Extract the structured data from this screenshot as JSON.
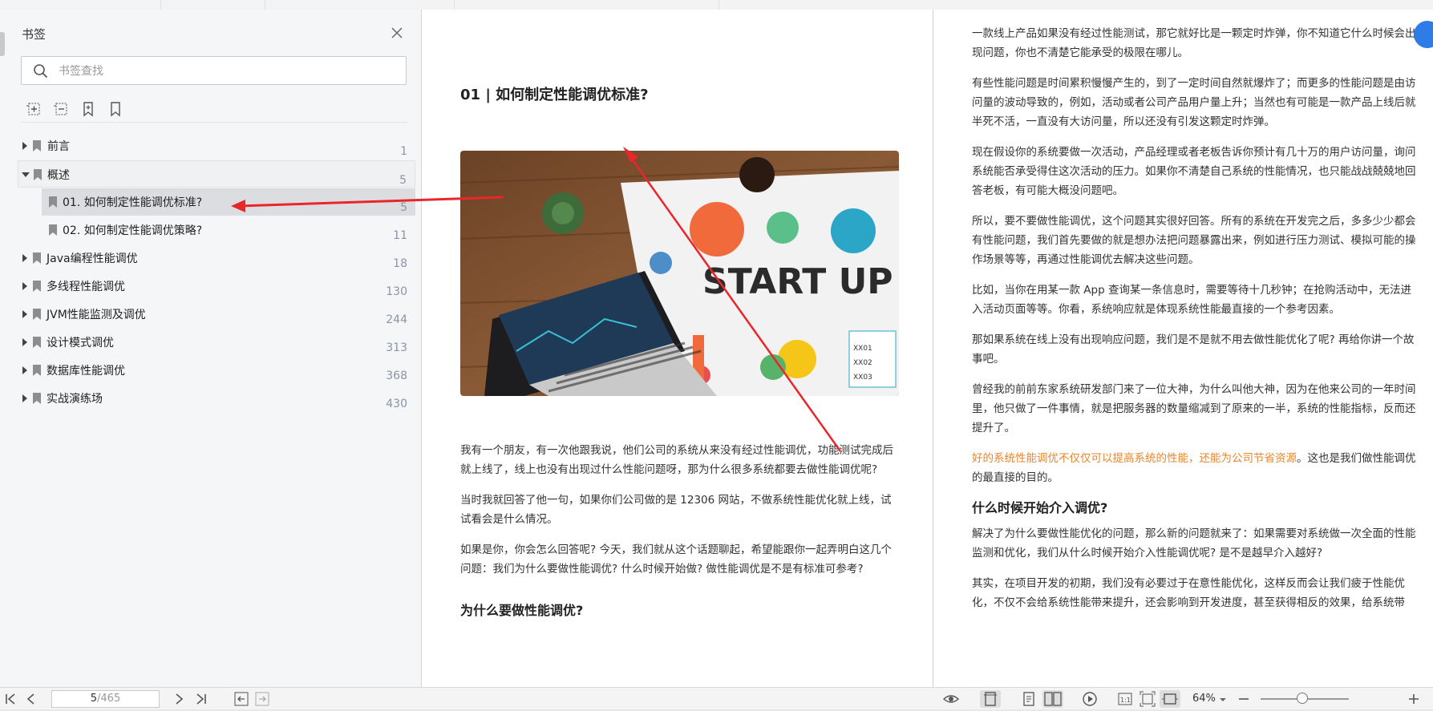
{
  "sidebar": {
    "title": "书签",
    "search_placeholder": "书签查找",
    "items": [
      {
        "label": "前言",
        "page": "1",
        "expand": "right",
        "indent": 0
      },
      {
        "label": "概述",
        "page": "5",
        "expand": "down",
        "indent": 0
      },
      {
        "label": "01. 如何制定性能调优标准?",
        "page": "5",
        "expand": "none",
        "indent": 1
      },
      {
        "label": "02. 如何制定性能调优策略?",
        "page": "11",
        "expand": "none",
        "indent": 1
      },
      {
        "label": "Java编程性能调优",
        "page": "18",
        "expand": "right",
        "indent": 0
      },
      {
        "label": "多线程性能调优",
        "page": "130",
        "expand": "right",
        "indent": 0
      },
      {
        "label": "JVM性能监测及调优",
        "page": "244",
        "expand": "right",
        "indent": 0
      },
      {
        "label": "设计模式调优",
        "page": "313",
        "expand": "right",
        "indent": 0
      },
      {
        "label": "数据库性能调优",
        "page": "368",
        "expand": "right",
        "indent": 0
      },
      {
        "label": "实战演练场",
        "page": "430",
        "expand": "right",
        "indent": 0
      }
    ]
  },
  "left_page": {
    "heading": "01 | 如何制定性能调优标准?",
    "hero_text": "START UP",
    "hero_list": [
      "XX01",
      "XX02",
      "XX03"
    ],
    "p1": "我有一个朋友，有一次他跟我说，他们公司的系统从来没有经过性能调优，功能测试完成后就上线了，线上也没有出现过什么性能问题呀，那为什么很多系统都要去做性能调优呢?",
    "p2": "当时我就回答了他一句，如果你们公司做的是 12306 网站，不做系统性能优化就上线，试试看会是什么情况。",
    "p3": "如果是你，你会怎么回答呢? 今天，我们就从这个话题聊起，希望能跟你一起弄明白这几个问题：我们为什么要做性能调优? 什么时候开始做? 做性能调优是不是有标准可参考?",
    "cut_heading": "为什么要做性能调优?"
  },
  "right_page": {
    "p1": "一款线上产品如果没有经过性能测试，那它就好比是一颗定时炸弹，你不知道它什么时候会出现问题，你也不清楚它能承受的极限在哪儿。",
    "p2": "有些性能问题是时间累积慢慢产生的，到了一定时间自然就爆炸了；而更多的性能问题是由访问量的波动导致的，例如，活动或者公司产品用户量上升；当然也有可能是一款产品上线后就半死不活，一直没有大访问量，所以还没有引发这颗定时炸弹。",
    "p3": "现在假设你的系统要做一次活动，产品经理或者老板告诉你预计有几十万的用户访问量，询问系统能否承受得住这次活动的压力。如果你不清楚自己系统的性能情况，也只能战战兢兢地回答老板，有可能大概没问题吧。",
    "p4": "所以，要不要做性能调优，这个问题其实很好回答。所有的系统在开发完之后，多多少少都会有性能问题，我们首先要做的就是想办法把问题暴露出来，例如进行压力测试、模拟可能的操作场景等等，再通过性能调优去解决这些问题。",
    "p5": "比如，当你在用某一款 App 查询某一条信息时，需要等待十几秒钟；在抢购活动中，无法进入活动页面等等。你看，系统响应就是体现系统性能最直接的一个参考因素。",
    "p6": "那如果系统在线上没有出现响应问题，我们是不是就不用去做性能优化了呢? 再给你讲一个故事吧。",
    "p7": "曾经我的前前东家系统研发部门来了一位大神，为什么叫他大神，因为在他来公司的一年时间里，他只做了一件事情，就是把服务器的数量缩减到了原来的一半，系统的性能指标，反而还提升了。",
    "p8_orange": "好的系统性能调优不仅仅可以提高系统的性能，还能为公司节省资源",
    "p8_rest": "。这也是我们做性能调优的最直接的目的。",
    "h2": "什么时候开始介入调优?",
    "p9": "解决了为什么要做性能优化的问题，那么新的问题就来了：如果需要对系统做一次全面的性能监测和优化，我们从什么时候开始介入性能调优呢? 是不是越早介入越好?",
    "p10": "其实，在项目开发的初期，我们没有必要过于在意性能优化，这样反而会让我们疲于性能优化，不仅不会给系统性能带来提升，还会影响到开发进度，甚至获得相反的效果，给系统带"
  },
  "bottom": {
    "current_page": "5",
    "total_pages": "/465",
    "zoom": "64%"
  },
  "colors": {
    "accent": "#2e7ce6",
    "annotation": "#e8262b",
    "highlight": "#e8852b"
  }
}
